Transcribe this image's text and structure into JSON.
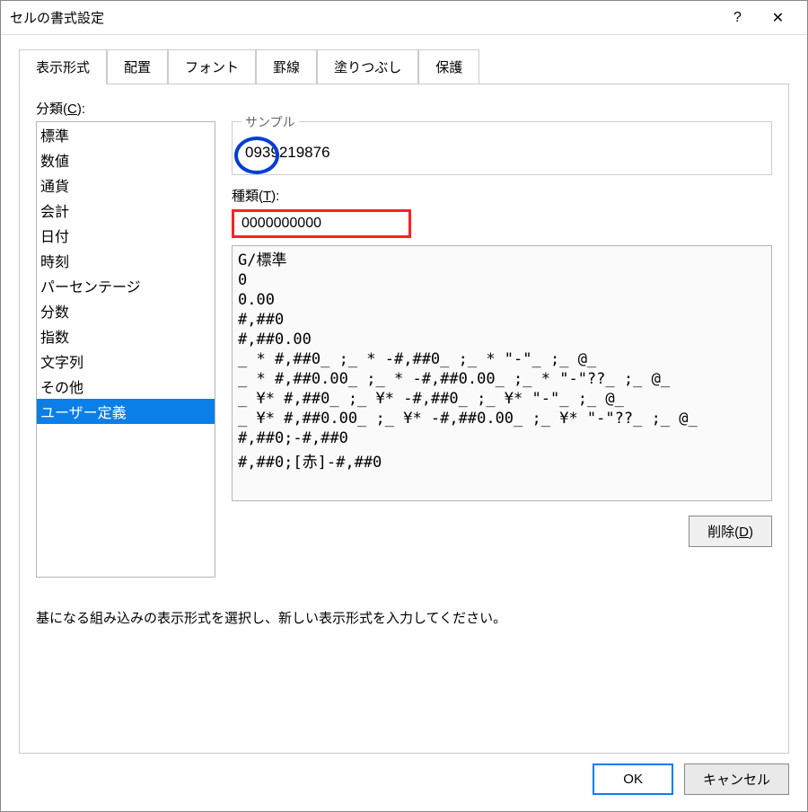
{
  "titlebar": {
    "title": "セルの書式設定",
    "help": "?",
    "close": "✕"
  },
  "tabs": [
    {
      "label": "表示形式",
      "active": true
    },
    {
      "label": "配置"
    },
    {
      "label": "フォント"
    },
    {
      "label": "罫線"
    },
    {
      "label": "塗りつぶし"
    },
    {
      "label": "保護"
    }
  ],
  "category": {
    "label": "分類(",
    "hotkey": "C",
    "label_suffix": "):",
    "items": [
      {
        "label": "標準"
      },
      {
        "label": "数値"
      },
      {
        "label": "通貨"
      },
      {
        "label": "会計"
      },
      {
        "label": "日付"
      },
      {
        "label": "時刻"
      },
      {
        "label": "パーセンテージ"
      },
      {
        "label": "分数"
      },
      {
        "label": "指数"
      },
      {
        "label": "文字列"
      },
      {
        "label": "その他"
      },
      {
        "label": "ユーザー定義",
        "selected": true
      }
    ]
  },
  "sample": {
    "label": "サンプル",
    "value": "0939219876"
  },
  "type": {
    "label": "種類(",
    "hotkey": "T",
    "label_suffix": "):",
    "value": "0000000000"
  },
  "formats": [
    "G/標準",
    "0",
    "0.00",
    "#,##0",
    "#,##0.00",
    "_ * #,##0_ ;_ * -#,##0_ ;_ * \"-\"_ ;_ @_ ",
    "_ * #,##0.00_ ;_ * -#,##0.00_ ;_ * \"-\"??_ ;_ @_ ",
    "_ ¥* #,##0_ ;_ ¥* -#,##0_ ;_ ¥* \"-\"_ ;_ @_ ",
    "_ ¥* #,##0.00_ ;_ ¥* -#,##0.00_ ;_ ¥* \"-\"??_ ;_ @_ ",
    "#,##0;-#,##0",
    "#,##0;[赤]-#,##0"
  ],
  "delete_btn": {
    "label": "削除(",
    "hotkey": "D",
    "suffix": ")"
  },
  "hint": "基になる組み込みの表示形式を選択し、新しい表示形式を入力してください。",
  "footer": {
    "ok": "OK",
    "cancel": "キャンセル"
  }
}
